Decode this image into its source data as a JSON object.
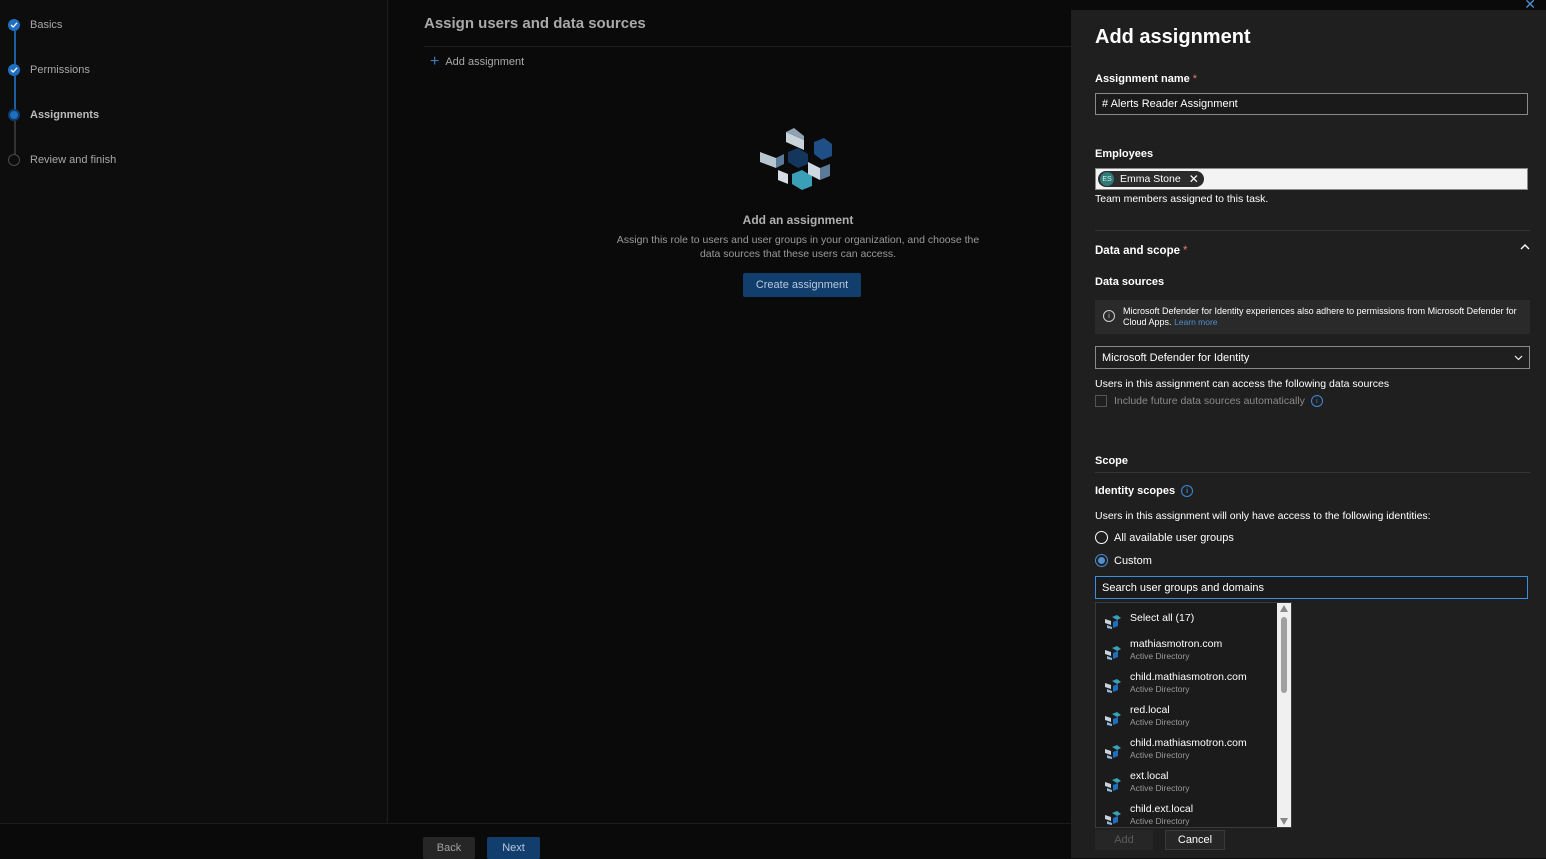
{
  "stepper": {
    "steps": [
      {
        "label": "Basics",
        "state": "done"
      },
      {
        "label": "Permissions",
        "state": "done"
      },
      {
        "label": "Assignments",
        "state": "current"
      },
      {
        "label": "Review and finish",
        "state": "todo"
      }
    ]
  },
  "main": {
    "title": "Assign users and data sources",
    "add_link": "Add assignment",
    "empty_title": "Add an assignment",
    "empty_desc": "Assign this role to users and user groups in your organization, and choose the data sources that these users can access.",
    "create_button": "Create assignment"
  },
  "footer": {
    "back": "Back",
    "next": "Next"
  },
  "panel": {
    "title": "Add assignment",
    "name_label": "Assignment name",
    "name_value": "# Alerts Reader Assignment",
    "employees_label": "Employees",
    "employee_chip": "Emma Stone",
    "employee_initials": "ES",
    "employees_help": "Team members assigned to this task.",
    "data_scope_label": "Data and scope",
    "data_sources_label": "Data sources",
    "info_text": "Microsoft Defender for Identity experiences also adhere to permissions from Microsoft Defender for Cloud Apps.",
    "info_link": "Learn more",
    "data_source_selected": "Microsoft Defender for Identity",
    "data_sources_help": "Users in this assignment can access the following data sources",
    "include_future_label": "Include future data sources automatically",
    "scope_label": "Scope",
    "identity_scopes_label": "Identity scopes",
    "identity_scopes_help": "Users in this assignment will only have access to the following identities:",
    "radio_all": "All available user groups",
    "radio_custom": "Custom",
    "search_placeholder": "Search user groups and domains",
    "add_button": "Add",
    "cancel_button": "Cancel"
  },
  "dropdown": {
    "select_all": "Select all (17)",
    "items": [
      {
        "name": "mathiasmotron.com",
        "type": "Active Directory"
      },
      {
        "name": "child.mathiasmotron.com",
        "type": "Active Directory"
      },
      {
        "name": "red.local",
        "type": "Active Directory"
      },
      {
        "name": "child.mathiasmotron.com",
        "type": "Active Directory"
      },
      {
        "name": "ext.local",
        "type": "Active Directory"
      },
      {
        "name": "child.ext.local",
        "type": "Active Directory"
      }
    ]
  },
  "colors": {
    "accent": "#1f6fc0",
    "primary_button": "#123e6e",
    "panel_bg": "#1f1f1f",
    "link": "#4e8fd0"
  }
}
